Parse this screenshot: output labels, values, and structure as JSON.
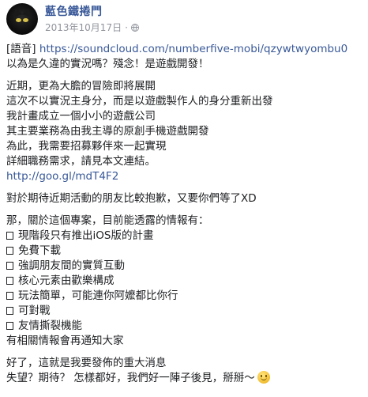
{
  "post": {
    "author": "藍色鐵捲門",
    "date": "2013年10月17日",
    "separator": "·",
    "privacy_icon": "globe-icon",
    "paragraphs": [
      {
        "lines": [
          {
            "prefix": "[語音] ",
            "link": "https://soundcloud.com/numberfive-mobi/qzywtwyombu0"
          },
          {
            "text": "以為是久違的實況嗎？殘念！是遊戲開發！"
          }
        ]
      },
      {
        "lines": [
          {
            "text": "近期，更為大膽的冒險即將展開"
          },
          {
            "text": "這次不以實況主身分，而是以遊戲製作人的身分重新出發"
          },
          {
            "text": "我計畫成立一個小小的遊戲公司"
          },
          {
            "text": "其主要業務為由我主導的原創手機遊戲開發"
          },
          {
            "text": "為此，我需要招募夥伴來一起實現"
          },
          {
            "text": "詳細職務需求，請見本文連結。"
          },
          {
            "link": "http://goo.gl/mdT4F2"
          }
        ]
      },
      {
        "lines": [
          {
            "text": "對於期待近期活動的朋友比較抱歉，又要你們等了XD"
          }
        ]
      },
      {
        "lines": [
          {
            "text": "那，關於這個專案，目前能透露的情報有："
          },
          {
            "bullet": true,
            "text": "現階段只有推出iOS版的計畫"
          },
          {
            "bullet": true,
            "text": "免費下載"
          },
          {
            "bullet": true,
            "text": "強調朋友間的實質互動"
          },
          {
            "bullet": true,
            "text": "核心元素由歡樂構成"
          },
          {
            "bullet": true,
            "text": "玩法簡單，可能連你阿嬤都比你行"
          },
          {
            "bullet": true,
            "text": "可對戰"
          },
          {
            "bullet": true,
            "text": "友情撕裂機能"
          },
          {
            "text": "有相關情報會再通知大家"
          }
        ]
      },
      {
        "lines": [
          {
            "text": "好了，這就是我要發佈的重大消息"
          },
          {
            "text": "失望？期待？ 怎樣都好，我們好一陣子後見，掰掰～",
            "emoji": "smiley-icon"
          }
        ]
      }
    ]
  }
}
